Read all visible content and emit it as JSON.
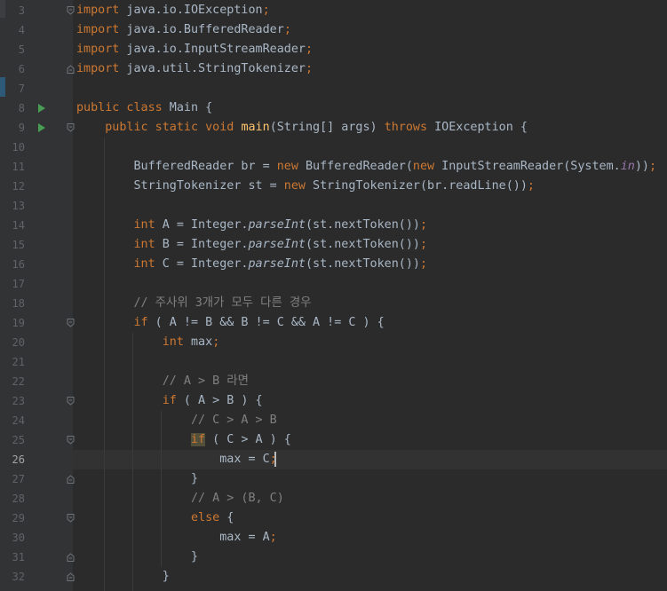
{
  "editor": {
    "current_line": "26",
    "lines": [
      {
        "num": "3",
        "text": "import java.io.IOException;"
      },
      {
        "num": "4",
        "text": "import java.io.BufferedReader;"
      },
      {
        "num": "5",
        "text": "import java.io.InputStreamReader;"
      },
      {
        "num": "6",
        "text": "import java.util.StringTokenizer;"
      },
      {
        "num": "7",
        "text": ""
      },
      {
        "num": "8",
        "text": "public class Main {"
      },
      {
        "num": "9",
        "text": "    public static void main(String[] args) throws IOException {"
      },
      {
        "num": "10",
        "text": ""
      },
      {
        "num": "11",
        "text": "        BufferedReader br = new BufferedReader(new InputStreamReader(System.in));"
      },
      {
        "num": "12",
        "text": "        StringTokenizer st = new StringTokenizer(br.readLine());"
      },
      {
        "num": "13",
        "text": ""
      },
      {
        "num": "14",
        "text": "        int A = Integer.parseInt(st.nextToken());"
      },
      {
        "num": "15",
        "text": "        int B = Integer.parseInt(st.nextToken());"
      },
      {
        "num": "16",
        "text": "        int C = Integer.parseInt(st.nextToken());"
      },
      {
        "num": "17",
        "text": ""
      },
      {
        "num": "18",
        "text": "        // 주사위 3개가 모두 다른 경우"
      },
      {
        "num": "19",
        "text": "        if ( A != B && B != C && A != C ) {"
      },
      {
        "num": "20",
        "text": "            int max;"
      },
      {
        "num": "21",
        "text": ""
      },
      {
        "num": "22",
        "text": "            // A > B 라면"
      },
      {
        "num": "23",
        "text": "            if ( A > B ) {"
      },
      {
        "num": "24",
        "text": "                // C > A > B"
      },
      {
        "num": "25",
        "text": "                if ( C > A ) {"
      },
      {
        "num": "26",
        "text": "                    max = C;"
      },
      {
        "num": "27",
        "text": "                }"
      },
      {
        "num": "28",
        "text": "                // A > (B, C)"
      },
      {
        "num": "29",
        "text": "                else {"
      },
      {
        "num": "30",
        "text": "                    max = A;"
      },
      {
        "num": "31",
        "text": "                }"
      },
      {
        "num": "32",
        "text": "            }"
      }
    ]
  },
  "colors": {
    "background": "#2b2b2b",
    "gutter": "#313335",
    "keyword": "#cc7832",
    "text": "#a9b7c6",
    "method_decl": "#ffc66d",
    "static_field": "#9876aa",
    "comment": "#808080",
    "line_number": "#606366",
    "run_icon": "#499c54"
  },
  "icons": {
    "run": "run-gutter-icon",
    "fold": "fold-marker-icon"
  }
}
